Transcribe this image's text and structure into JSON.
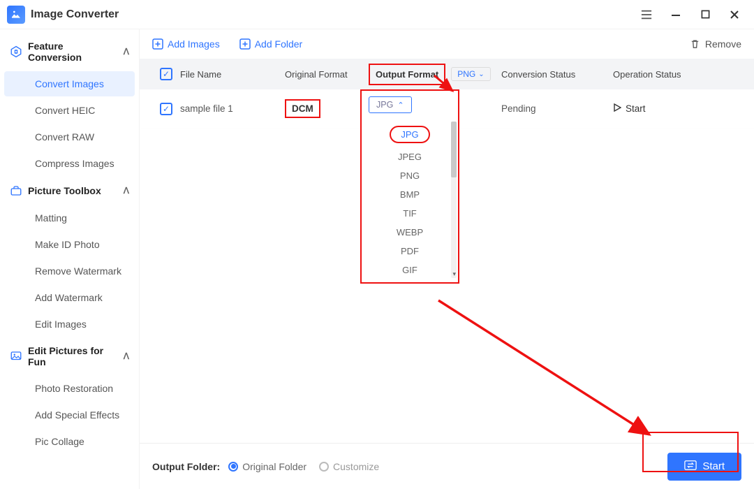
{
  "titlebar": {
    "title": "Image Converter"
  },
  "sidebar": {
    "groups": [
      {
        "label": "Feature Conversion",
        "icon": "feature-conversion-icon",
        "items": [
          {
            "label": "Convert Images",
            "active": true
          },
          {
            "label": "Convert HEIC"
          },
          {
            "label": "Convert RAW"
          },
          {
            "label": "Compress Images"
          }
        ]
      },
      {
        "label": "Picture Toolbox",
        "icon": "picture-toolbox-icon",
        "items": [
          {
            "label": "Matting"
          },
          {
            "label": "Make ID Photo"
          },
          {
            "label": "Remove Watermark"
          },
          {
            "label": "Add Watermark"
          },
          {
            "label": "Edit Images"
          }
        ]
      },
      {
        "label": "Edit Pictures for Fun",
        "icon": "edit-fun-icon",
        "items": [
          {
            "label": "Photo Restoration"
          },
          {
            "label": "Add Special Effects"
          },
          {
            "label": "Pic Collage"
          }
        ]
      }
    ]
  },
  "toolbar": {
    "add_images": "Add Images",
    "add_folder": "Add Folder",
    "remove": "Remove"
  },
  "table": {
    "headers": {
      "file_name": "File Name",
      "original_format": "Original Format",
      "output_format": "Output Format",
      "conversion_status": "Conversion Status",
      "operation_status": "Operation Status"
    },
    "header_output_select": "PNG",
    "rows": [
      {
        "file_name": "sample file 1",
        "original_format": "DCM",
        "output_format": "JPG",
        "conversion_status": "Pending",
        "operation_status": "Start"
      }
    ]
  },
  "dropdown": {
    "options": [
      "JPG",
      "JPEG",
      "PNG",
      "BMP",
      "TIF",
      "WEBP",
      "PDF",
      "GIF"
    ]
  },
  "bottom": {
    "label": "Output Folder:",
    "option_original": "Original Folder",
    "option_customize": "Customize",
    "start": "Start"
  }
}
